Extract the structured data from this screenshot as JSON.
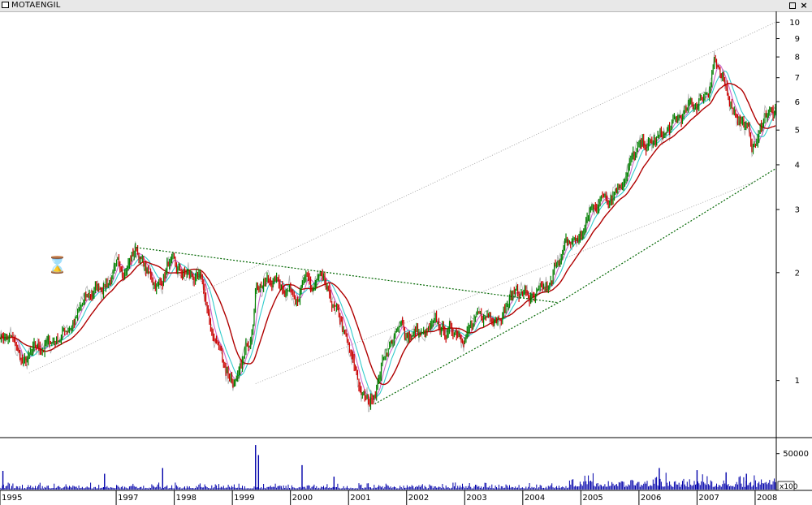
{
  "window": {
    "title": "MOTAENGIL",
    "restore_glyph": "",
    "close_glyph": "×",
    "icon": "document-icon"
  },
  "cursor_icon": "hourglass-icon",
  "cursor_glyph": "⌛",
  "colors": {
    "price_up": "#008000",
    "price_down": "#cc0000",
    "ma_short": "#cc66cc",
    "ma_mid": "#33cccc",
    "ma_long": "#b00000",
    "shadow": "#b0b0b0",
    "trendline": "#006600",
    "channel": "#a0a0a0",
    "volume": "#0000aa"
  },
  "chart_data": [
    {
      "type": "line",
      "name": "price-panel",
      "title": "MOTAENGIL",
      "yscale": "log",
      "ylim": [
        0.7,
        10.5
      ],
      "xlim": [
        1995.0,
        2008.35
      ],
      "x_tick_labels": [
        "1995",
        "1997",
        "1998",
        "1999",
        "2000",
        "2001",
        "2002",
        "2003",
        "2004",
        "2005",
        "2006",
        "2007",
        "2008"
      ],
      "x_tick_positions": [
        1995.0,
        1997.0,
        1998.0,
        1999.0,
        2000.0,
        2001.0,
        2002.0,
        2003.0,
        2004.0,
        2005.0,
        2006.0,
        2007.0,
        2008.0
      ],
      "y_tick_labels": [
        "10",
        "9",
        "8",
        "7",
        "6",
        "5",
        "4",
        "3",
        "2",
        "1"
      ],
      "y_tick_values": [
        10,
        9,
        8,
        7,
        6,
        5,
        4,
        3,
        2,
        1
      ],
      "grid": false,
      "price_points": {
        "x": [
          1995.0,
          1995.2,
          1995.4,
          1995.7,
          1996.0,
          1996.3,
          1996.6,
          1996.9,
          1997.1,
          1997.35,
          1997.55,
          1997.75,
          1997.9,
          1998.05,
          1998.3,
          1998.5,
          1998.6,
          1998.75,
          1998.9,
          1999.1,
          1999.3,
          1999.42,
          1999.55,
          1999.75,
          1999.9,
          2000.1,
          2000.25,
          2000.35,
          2000.5,
          2000.65,
          2000.85,
          2001.0,
          2001.1,
          2001.25,
          2001.35,
          2001.5,
          2001.62,
          2001.75,
          2001.9,
          2002.0,
          2002.15,
          2002.3,
          2002.5,
          2002.7,
          2002.9,
          2003.1,
          2003.3,
          2003.5,
          2003.7,
          2003.9,
          2004.05,
          2004.2,
          2004.35,
          2004.5,
          2004.6,
          2004.75,
          2004.85,
          2005.0,
          2005.15,
          2005.3,
          2005.5,
          2005.7,
          2005.9,
          2006.05,
          2006.2,
          2006.35,
          2006.5,
          2006.7,
          2006.9,
          2007.05,
          2007.2,
          2007.3,
          2007.42,
          2007.5,
          2007.65,
          2007.8,
          2007.95,
          2008.05,
          2008.15,
          2008.25,
          2008.32
        ],
        "y": [
          1.35,
          1.3,
          1.1,
          1.22,
          1.32,
          1.5,
          1.75,
          1.95,
          2.05,
          2.35,
          1.95,
          1.85,
          2.15,
          1.95,
          1.95,
          1.8,
          1.4,
          1.25,
          1.08,
          0.98,
          1.3,
          1.95,
          1.9,
          1.9,
          1.85,
          1.8,
          1.9,
          1.75,
          1.9,
          1.65,
          1.45,
          1.2,
          1.05,
          0.9,
          0.85,
          1.0,
          1.2,
          1.3,
          1.38,
          1.35,
          1.38,
          1.32,
          1.38,
          1.35,
          1.4,
          1.42,
          1.45,
          1.55,
          1.65,
          1.8,
          1.75,
          1.65,
          1.7,
          1.8,
          2.2,
          2.35,
          2.4,
          2.5,
          2.9,
          3.2,
          3.4,
          3.7,
          4.2,
          4.4,
          4.5,
          4.7,
          4.9,
          5.3,
          5.7,
          6.1,
          6.6,
          8.2,
          6.6,
          6.3,
          5.8,
          5.3,
          4.5,
          4.7,
          5.4,
          5.8,
          5.5
        ]
      },
      "series": [
        {
          "color": "#cc66cc",
          "smoothing": 6
        },
        {
          "color": "#33cccc",
          "smoothing": 12
        },
        {
          "color": "#b00000",
          "smoothing": 26
        }
      ],
      "annotations": [
        {
          "kind": "dotted-line",
          "color": "#006600",
          "from": [
            1997.35,
            2.35
          ],
          "to": [
            2004.6,
            1.65
          ]
        },
        {
          "kind": "dotted-line",
          "color": "#006600",
          "from": [
            2001.45,
            0.86
          ],
          "to": [
            2004.7,
            1.68
          ]
        },
        {
          "kind": "dotted-line",
          "color": "#006600",
          "from": [
            2004.7,
            1.68
          ],
          "to": [
            2008.35,
            3.9
          ]
        },
        {
          "kind": "dotted-line",
          "color": "#a0a0a0",
          "from": [
            1995.5,
            1.05
          ],
          "to": [
            2008.35,
            10.0
          ]
        },
        {
          "kind": "dotted-line",
          "color": "#a0a0a0",
          "from": [
            1999.4,
            0.98
          ],
          "to": [
            2008.0,
            3.6
          ]
        }
      ]
    },
    {
      "type": "bar",
      "name": "volume-panel",
      "y_tick_labels": [
        "50000"
      ],
      "y_tick_values": [
        50000
      ],
      "ylim": [
        0,
        70000
      ],
      "multiplier_label": "x100",
      "color": "#0000aa",
      "spikes": {
        "x": [
          1995.05,
          1996.8,
          1997.8,
          1999.4,
          1999.45,
          2000.2,
          2000.75,
          2006.35,
          2007.0,
          2007.5,
          2007.85
        ],
        "y": [
          26000,
          22000,
          30000,
          62000,
          48000,
          34000,
          18000,
          30000,
          27000,
          24000,
          22000
        ]
      }
    }
  ]
}
